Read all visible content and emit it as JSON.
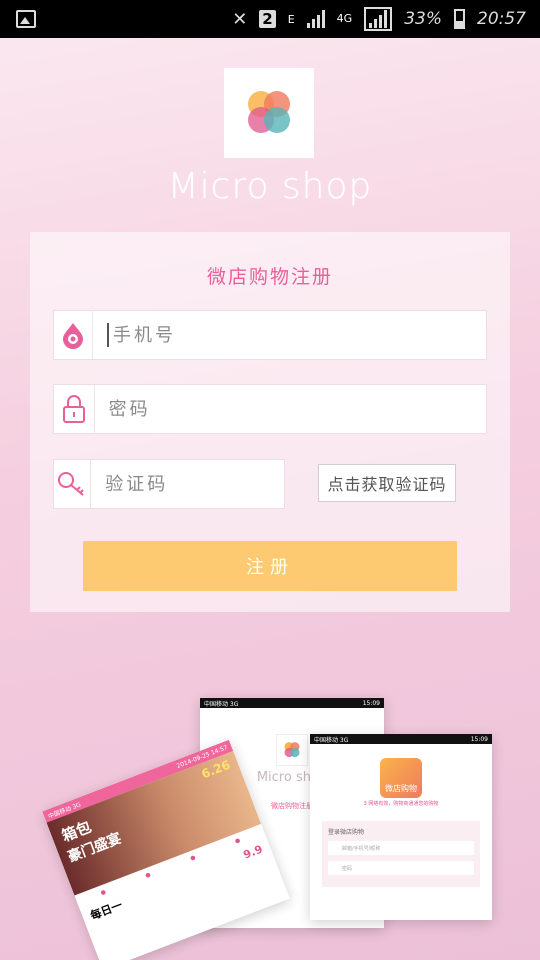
{
  "status_bar": {
    "sim_slot": "2",
    "network_e": "E",
    "network_4g": "4G",
    "battery": "33%",
    "time": "20:57",
    "icons": [
      "gallery-icon",
      "mute-icon",
      "signal-icon",
      "battery-icon"
    ]
  },
  "app": {
    "brand": "Micro shop",
    "logo_colors": [
      "#f9b44a",
      "#f07a5c",
      "#58b4b8",
      "#e0568e"
    ]
  },
  "form": {
    "title": "微店购物注册",
    "phone_placeholder": "手机号",
    "password_placeholder": "密码",
    "code_placeholder": "验证码",
    "get_code_label": "点击获取验证码",
    "submit_label": "注册"
  },
  "preview": {
    "left": {
      "carrier": "中国移动 3G",
      "date": "2014-09-25 14:57",
      "banner_line1": "箱包",
      "banner_line2": "豪门盛宴",
      "banner_badge": "6.26",
      "promo_left": "每日一",
      "promo_right": "9.9"
    },
    "mid": {
      "carrier": "中国移动 3G",
      "time": "15:09",
      "brand": "Micro shop",
      "title": "微店购物注册"
    },
    "right": {
      "carrier": "中国移动 3G",
      "time": "15:09",
      "app_name": "微店购物",
      "subtitle": "3 网络有效，购物商通通您的购物",
      "form_title": "登录微店购物",
      "username_placeholder": "邮箱/手机号/昵称",
      "password_placeholder": "密码"
    }
  },
  "colors": {
    "accent_pink": "#e95f9a",
    "submit_yellow": "#fdca72",
    "background": "#f5cfdf"
  }
}
